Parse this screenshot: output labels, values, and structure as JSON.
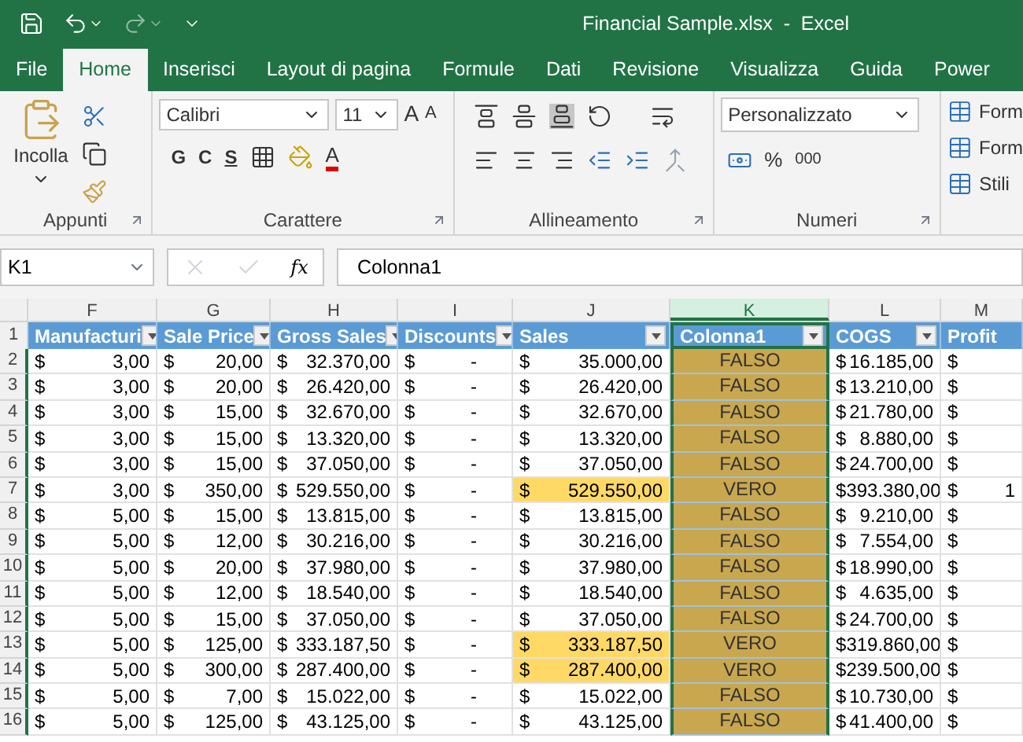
{
  "window": {
    "title": "Financial Sample.xlsx  -  Excel"
  },
  "tabs": [
    {
      "label": "File",
      "selected": false
    },
    {
      "label": "Home",
      "selected": true
    },
    {
      "label": "Inserisci",
      "selected": false
    },
    {
      "label": "Layout di pagina",
      "selected": false
    },
    {
      "label": "Formule",
      "selected": false
    },
    {
      "label": "Dati",
      "selected": false
    },
    {
      "label": "Revisione",
      "selected": false
    },
    {
      "label": "Visualizza",
      "selected": false
    },
    {
      "label": "Guida",
      "selected": false
    },
    {
      "label": "Power",
      "selected": false
    }
  ],
  "ribbon": {
    "paste_label": "Incolla",
    "font": "Calibri",
    "size": "11",
    "bold": "G",
    "italic": "C",
    "underline": "S",
    "number_format": "Personalizzato",
    "grow_font": "A",
    "shrink_font": "A",
    "font_color": "A",
    "function": "fx",
    "percent": "%",
    "thousands": "000",
    "styles": [
      "Form",
      "Form",
      "Stili"
    ],
    "groups": [
      "Appunti",
      "Carattere",
      "Allineamento",
      "Numeri"
    ]
  },
  "formula_bar": {
    "name_box": "K1",
    "formula": "Colonna1"
  },
  "columns": [
    {
      "letter": "F",
      "header": "Manufacturi",
      "kind": "currency",
      "selected": false
    },
    {
      "letter": "G",
      "header": "Sale Price",
      "kind": "currency",
      "selected": false
    },
    {
      "letter": "H",
      "header": "Gross Sales",
      "kind": "currency",
      "selected": false
    },
    {
      "letter": "I",
      "header": "Discounts",
      "kind": "dash",
      "selected": false
    },
    {
      "letter": "J",
      "header": "Sales",
      "kind": "currency",
      "selected": false
    },
    {
      "letter": "K",
      "header": "Colonna1",
      "kind": "flag",
      "selected": true
    },
    {
      "letter": "L",
      "header": "COGS",
      "kind": "currency",
      "selected": false
    },
    {
      "letter": "M",
      "header": "Profit",
      "kind": "currency",
      "selected": false
    }
  ],
  "header_row": "1",
  "rows": [
    {
      "n": "2",
      "highlighted": false,
      "cells": [
        [
          "$",
          "3,00"
        ],
        [
          "$",
          "20,00"
        ],
        [
          "$",
          "32.370,00"
        ],
        [
          "$",
          "-"
        ],
        [
          "$",
          "35.000,00"
        ],
        [
          "FALSO"
        ],
        [
          "$",
          "16.185,00"
        ],
        [
          "$"
        ]
      ]
    },
    {
      "n": "3",
      "highlighted": false,
      "cells": [
        [
          "$",
          "3,00"
        ],
        [
          "$",
          "20,00"
        ],
        [
          "$",
          "26.420,00"
        ],
        [
          "$",
          "-"
        ],
        [
          "$",
          "26.420,00"
        ],
        [
          "FALSO"
        ],
        [
          "$",
          "13.210,00"
        ],
        [
          "$"
        ]
      ]
    },
    {
      "n": "4",
      "highlighted": false,
      "cells": [
        [
          "$",
          "3,00"
        ],
        [
          "$",
          "15,00"
        ],
        [
          "$",
          "32.670,00"
        ],
        [
          "$",
          "-"
        ],
        [
          "$",
          "32.670,00"
        ],
        [
          "FALSO"
        ],
        [
          "$",
          "21.780,00"
        ],
        [
          "$"
        ]
      ]
    },
    {
      "n": "5",
      "highlighted": false,
      "cells": [
        [
          "$",
          "3,00"
        ],
        [
          "$",
          "15,00"
        ],
        [
          "$",
          "13.320,00"
        ],
        [
          "$",
          "-"
        ],
        [
          "$",
          "13.320,00"
        ],
        [
          "FALSO"
        ],
        [
          "$",
          "8.880,00"
        ],
        [
          "$"
        ]
      ]
    },
    {
      "n": "6",
      "highlighted": false,
      "cells": [
        [
          "$",
          "3,00"
        ],
        [
          "$",
          "15,00"
        ],
        [
          "$",
          "37.050,00"
        ],
        [
          "$",
          "-"
        ],
        [
          "$",
          "37.050,00"
        ],
        [
          "FALSO"
        ],
        [
          "$",
          "24.700,00"
        ],
        [
          "$"
        ]
      ]
    },
    {
      "n": "7",
      "highlighted": true,
      "cells": [
        [
          "$",
          "3,00"
        ],
        [
          "$",
          "350,00"
        ],
        [
          "$",
          "529.550,00"
        ],
        [
          "$",
          "-"
        ],
        [
          "$",
          "529.550,00"
        ],
        [
          "VERO"
        ],
        [
          "$",
          "393.380,00"
        ],
        [
          "$",
          "1"
        ]
      ]
    },
    {
      "n": "8",
      "highlighted": false,
      "cells": [
        [
          "$",
          "5,00"
        ],
        [
          "$",
          "15,00"
        ],
        [
          "$",
          "13.815,00"
        ],
        [
          "$",
          "-"
        ],
        [
          "$",
          "13.815,00"
        ],
        [
          "FALSO"
        ],
        [
          "$",
          "9.210,00"
        ],
        [
          "$"
        ]
      ]
    },
    {
      "n": "9",
      "highlighted": false,
      "cells": [
        [
          "$",
          "5,00"
        ],
        [
          "$",
          "12,00"
        ],
        [
          "$",
          "30.216,00"
        ],
        [
          "$",
          "-"
        ],
        [
          "$",
          "30.216,00"
        ],
        [
          "FALSO"
        ],
        [
          "$",
          "7.554,00"
        ],
        [
          "$"
        ]
      ]
    },
    {
      "n": "10",
      "highlighted": false,
      "cells": [
        [
          "$",
          "5,00"
        ],
        [
          "$",
          "20,00"
        ],
        [
          "$",
          "37.980,00"
        ],
        [
          "$",
          "-"
        ],
        [
          "$",
          "37.980,00"
        ],
        [
          "FALSO"
        ],
        [
          "$",
          "18.990,00"
        ],
        [
          "$"
        ]
      ]
    },
    {
      "n": "11",
      "highlighted": false,
      "cells": [
        [
          "$",
          "5,00"
        ],
        [
          "$",
          "12,00"
        ],
        [
          "$",
          "18.540,00"
        ],
        [
          "$",
          "-"
        ],
        [
          "$",
          "18.540,00"
        ],
        [
          "FALSO"
        ],
        [
          "$",
          "4.635,00"
        ],
        [
          "$"
        ]
      ]
    },
    {
      "n": "12",
      "highlighted": false,
      "cells": [
        [
          "$",
          "5,00"
        ],
        [
          "$",
          "15,00"
        ],
        [
          "$",
          "37.050,00"
        ],
        [
          "$",
          "-"
        ],
        [
          "$",
          "37.050,00"
        ],
        [
          "FALSO"
        ],
        [
          "$",
          "24.700,00"
        ],
        [
          "$"
        ]
      ]
    },
    {
      "n": "13",
      "highlighted": true,
      "cells": [
        [
          "$",
          "5,00"
        ],
        [
          "$",
          "125,00"
        ],
        [
          "$",
          "333.187,50"
        ],
        [
          "$",
          "-"
        ],
        [
          "$",
          "333.187,50"
        ],
        [
          "VERO"
        ],
        [
          "$",
          "319.860,00"
        ],
        [
          "$"
        ]
      ]
    },
    {
      "n": "14",
      "highlighted": true,
      "cells": [
        [
          "$",
          "5,00"
        ],
        [
          "$",
          "300,00"
        ],
        [
          "$",
          "287.400,00"
        ],
        [
          "$",
          "-"
        ],
        [
          "$",
          "287.400,00"
        ],
        [
          "VERO"
        ],
        [
          "$",
          "239.500,00"
        ],
        [
          "$"
        ]
      ]
    },
    {
      "n": "15",
      "highlighted": false,
      "cells": [
        [
          "$",
          "5,00"
        ],
        [
          "$",
          "7,00"
        ],
        [
          "$",
          "15.022,00"
        ],
        [
          "$",
          "-"
        ],
        [
          "$",
          "15.022,00"
        ],
        [
          "FALSO"
        ],
        [
          "$",
          "10.730,00"
        ],
        [
          "$"
        ]
      ]
    },
    {
      "n": "16",
      "highlighted": false,
      "cells": [
        [
          "$",
          "5,00"
        ],
        [
          "$",
          "125,00"
        ],
        [
          "$",
          "43.125,00"
        ],
        [
          "$",
          "-"
        ],
        [
          "$",
          "43.125,00"
        ],
        [
          "FALSO"
        ],
        [
          "$",
          "41.400,00"
        ],
        [
          "$"
        ]
      ]
    }
  ]
}
